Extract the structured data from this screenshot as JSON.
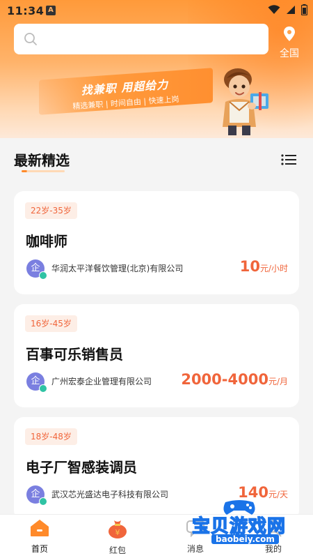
{
  "status": {
    "time": "11:34",
    "notif_letter": "A"
  },
  "search": {
    "placeholder": "",
    "value": ""
  },
  "location": {
    "label": "全国"
  },
  "banner": {
    "title": "找兼职 用超给力",
    "subtitle": "精选兼职 | 时间自由 | 快速上岗"
  },
  "section": {
    "title": "最新精选"
  },
  "jobs": [
    {
      "age": "22岁-35岁",
      "title": "咖啡师",
      "company_badge": "企",
      "company": "华润太平洋餐饮管理(北京)有限公司",
      "salary": "10",
      "unit": "元/小时"
    },
    {
      "age": "16岁-45岁",
      "title": "百事可乐销售员",
      "company_badge": "企",
      "company": "广州宏泰企业管理有限公司",
      "salary": "2000-4000",
      "unit": "元/月"
    },
    {
      "age": "18岁-48岁",
      "title": "电子厂智感装调员",
      "company_badge": "企",
      "company": "武汉芯光盛达电子科技有限公司",
      "salary": "140",
      "unit": "元/天"
    }
  ],
  "tabs": [
    {
      "label": "首页"
    },
    {
      "label": "红包"
    },
    {
      "label": "消息"
    },
    {
      "label": "我的"
    }
  ],
  "watermark": {
    "text": "宝贝游戏网",
    "url": "baobeiy.com"
  },
  "colors": {
    "accent": "#ff8a2a",
    "salary": "#f0653b",
    "avatar": "#7a7fe0",
    "verified": "#2fc3a4"
  }
}
